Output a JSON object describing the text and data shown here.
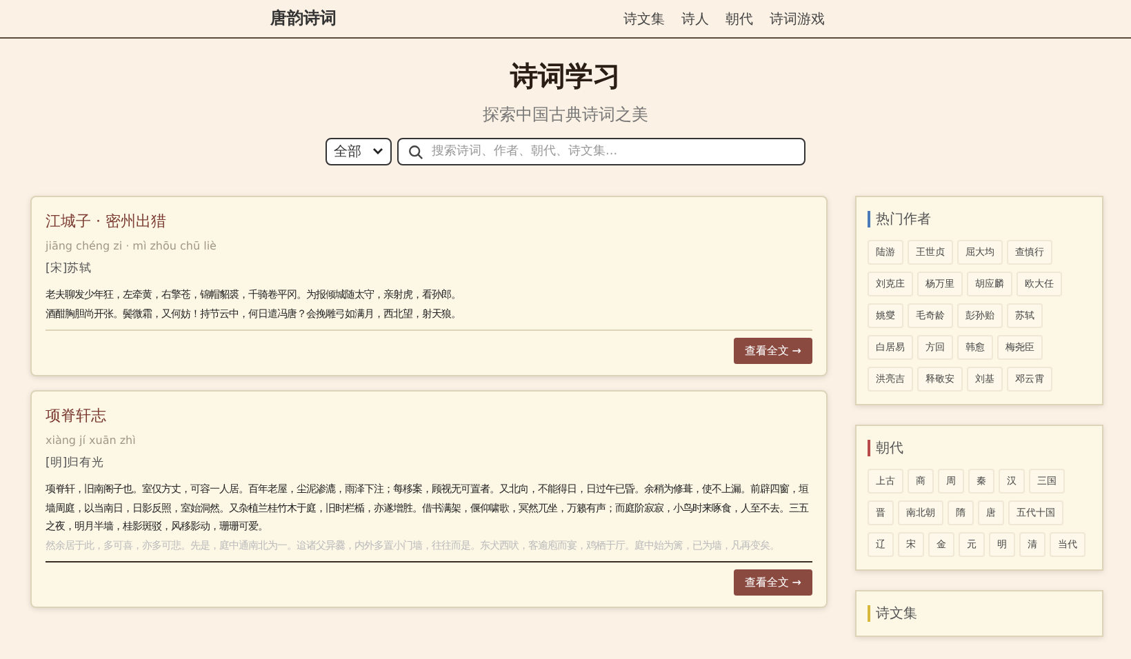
{
  "header": {
    "logo": "唐韵诗词",
    "nav": [
      {
        "label": "诗文集"
      },
      {
        "label": "诗人"
      },
      {
        "label": "朝代"
      },
      {
        "label": "诗词游戏"
      }
    ]
  },
  "hero": {
    "title": "诗词学习",
    "subtitle": "探索中国古典诗词之美"
  },
  "search": {
    "scope": "全部",
    "placeholder": "搜索诗词、作者、朝代、诗文集..."
  },
  "poems": [
    {
      "title": "江城子 · 密州出猎",
      "pinyin": "jiāng chéng zi · mì zhōu chū liè",
      "author": "[宋]苏轼",
      "lines": [
        "老夫聊发少年狂，左牵黄，右擎苍，锦帽貂裘，千骑卷平冈。为报倾城随太守，亲射虎，看孙郎。",
        "酒酣胸胆尚开张。鬓微霜，又何妨！持节云中，何日遣冯唐？会挽雕弓如满月，西北望，射天狼。"
      ],
      "truncated": false,
      "button": "查看全文 →"
    },
    {
      "title": "项脊轩志",
      "pinyin": "xiàng jí xuān zhì",
      "author": "[明]归有光",
      "lines": [
        "项脊轩，旧南阁子也。室仅方丈，可容一人居。百年老屋，尘泥渗漉，雨泽下注；每移案，顾视无可置者。又北向，不能得日，日过午已昏。余稍为修葺，使不上漏。前辟四窗，垣墙周庭，以当南日，日影反照，室始洞然。又杂植兰桂竹木于庭，旧时栏楯，亦遂增胜。借书满架，偃仰啸歌，冥然兀坐，万籁有声；而庭阶寂寂，小鸟时来啄食，人至不去。三五之夜，明月半墙，桂影斑驳，风移影动，珊珊可爱。",
        "然余居于此，多可喜，亦多可悲。先是，庭中通南北为一。迨诸父异爨，内外多置小门墙，往往而是。东犬西吠，客逾庖而宴，鸡栖于厅。庭中始为篱，已为墙，凡再变矣。"
      ],
      "truncated": true,
      "button": "查看全文 →"
    }
  ],
  "sidebar": [
    {
      "title": "热门作者",
      "color": "#4a7ab8",
      "tags": [
        "陆游",
        "王世贞",
        "屈大均",
        "查慎行",
        "刘克庄",
        "杨万里",
        "胡应麟",
        "欧大任",
        "姚燮",
        "毛奇龄",
        "彭孙贻",
        "苏轼",
        "白居易",
        "方回",
        "韩愈",
        "梅尧臣",
        "洪亮吉",
        "释敬安",
        "刘基",
        "邓云霄"
      ]
    },
    {
      "title": "朝代",
      "color": "#b84a4a",
      "tags": [
        "上古",
        "商",
        "周",
        "秦",
        "汉",
        "三国",
        "晋",
        "南北朝",
        "隋",
        "唐",
        "五代十国",
        "辽",
        "宋",
        "金",
        "元",
        "明",
        "清",
        "当代"
      ]
    },
    {
      "title": "诗文集",
      "color": "#d8b83a"
    }
  ]
}
